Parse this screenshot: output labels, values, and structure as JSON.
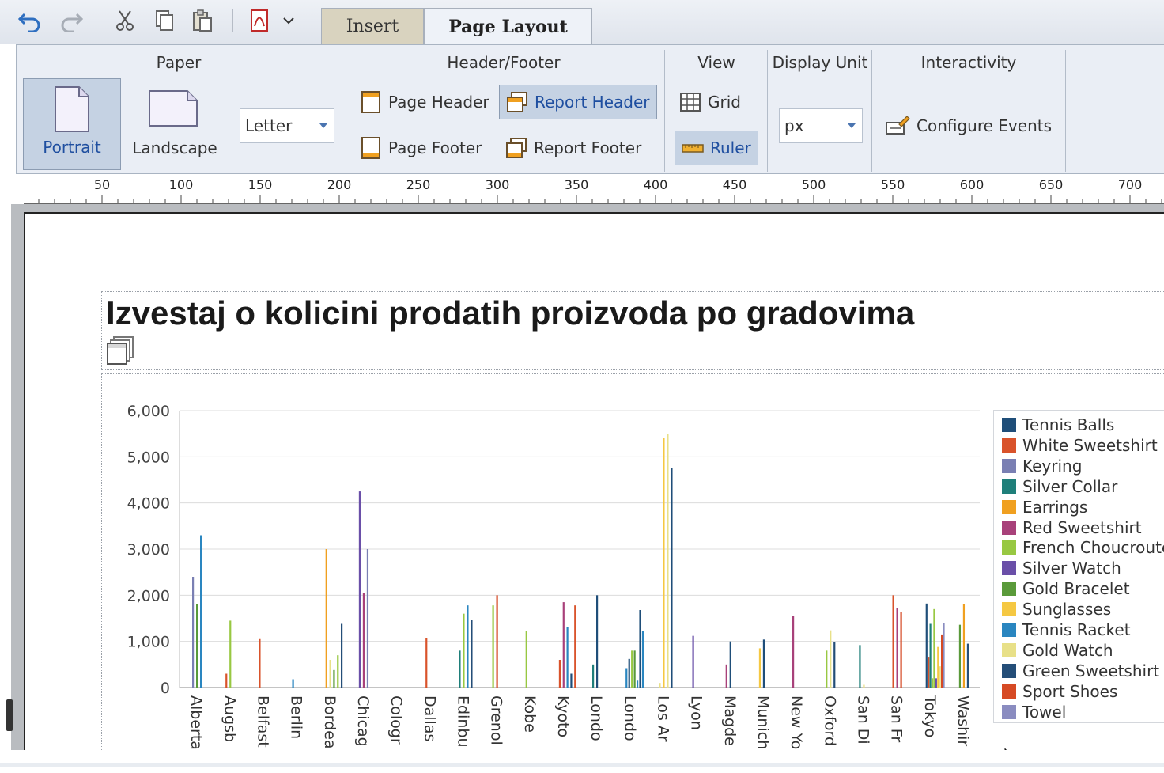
{
  "toolbar": {
    "icons": [
      "undo-icon",
      "redo-icon",
      "cut-icon",
      "copy-icon",
      "paste-icon",
      "pdf-icon",
      "chevron-down-icon"
    ]
  },
  "tabs": [
    {
      "label": "Insert",
      "active": false
    },
    {
      "label": "Page Layout",
      "active": true
    }
  ],
  "ribbon": {
    "paper": {
      "title": "Paper",
      "portrait": "Portrait",
      "landscape": "Landscape",
      "size": "Letter"
    },
    "header_footer": {
      "title": "Header/Footer",
      "page_header": "Page Header",
      "report_header": "Report Header",
      "page_footer": "Page Footer",
      "report_footer": "Report Footer"
    },
    "view": {
      "title": "View",
      "grid": "Grid",
      "ruler": "Ruler"
    },
    "display_unit": {
      "title": "Display Unit",
      "value": "px"
    },
    "interactivity": {
      "title": "Interactivity",
      "configure_events": "Configure Events"
    }
  },
  "ruler": {
    "labels": [
      "50",
      "100",
      "150",
      "200",
      "250",
      "300",
      "350",
      "400",
      "450",
      "500",
      "550",
      "600",
      "650",
      "700"
    ]
  },
  "report": {
    "title": "Izvestaj o kolicini prodatih proizvoda po gradovima"
  },
  "chart_data": {
    "type": "bar",
    "title": "",
    "xlabel": "",
    "ylabel": "",
    "ylim": [
      0,
      6000
    ],
    "yticks": [
      0,
      1000,
      2000,
      3000,
      4000,
      5000,
      6000
    ],
    "ytick_labels": [
      "0",
      "1,000",
      "2,000",
      "3,000",
      "4,000",
      "5,000",
      "6,000"
    ],
    "grid": true,
    "legend_position": "right",
    "categories": [
      "Alberta",
      "Augsburg",
      "Belfast",
      "Berlin",
      "Bordeaux",
      "Chicago",
      "Cologne",
      "Dallas",
      "Edinburgh",
      "Grenoble",
      "Kobe",
      "Kyoto",
      "London",
      "London",
      "Los Angeles",
      "Lyon",
      "Magdeburg",
      "Munich",
      "New York",
      "Oxford",
      "San Diego",
      "San Francisco",
      "Tokyo",
      "Washington"
    ],
    "category_labels": [
      "Alberta",
      "Augsb",
      "Belfast",
      "Berlin",
      "Bordea",
      "Chicag",
      "Cologr",
      "Dallas",
      "Edinbu",
      "Grenol",
      "Kobe",
      "Kyoto",
      "Londo",
      "Londo",
      "Los Ar",
      "Lyon",
      "Magde",
      "Munich",
      "New Yo",
      "Oxford",
      "San Di",
      "San Fr",
      "Tokyo",
      "Washir"
    ],
    "series": [
      {
        "name": "Tennis Balls",
        "color": "#1f4e79"
      },
      {
        "name": "White Sweetshirt",
        "color": "#d9532b"
      },
      {
        "name": "Keyring",
        "color": "#7a7fb3"
      },
      {
        "name": "Silver Collar",
        "color": "#1f7f7a"
      },
      {
        "name": "Earrings",
        "color": "#f0a020"
      },
      {
        "name": "Red Sweetshirt",
        "color": "#a8417a"
      },
      {
        "name": "French Choucroute",
        "color": "#98c842"
      },
      {
        "name": "Silver Watch",
        "color": "#6a4fa8"
      },
      {
        "name": "Gold Bracelet",
        "color": "#5a9a3a"
      },
      {
        "name": "Sunglasses",
        "color": "#f5c842"
      },
      {
        "name": "Tennis Racket",
        "color": "#2a86c0"
      },
      {
        "name": "Gold Watch",
        "color": "#e8e088"
      },
      {
        "name": "Green Sweetshirt",
        "color": "#244e78"
      },
      {
        "name": "Sport Shoes",
        "color": "#d64a24"
      },
      {
        "name": "Towel",
        "color": "#8a8cc0"
      }
    ],
    "bars": [
      {
        "category": 0,
        "series": "Keyring",
        "value": 2400
      },
      {
        "category": 0,
        "series": "Gold Bracelet",
        "value": 1800
      },
      {
        "category": 0,
        "series": "Tennis Racket",
        "value": 3300
      },
      {
        "category": 1,
        "series": "White Sweetshirt",
        "value": 300
      },
      {
        "category": 1,
        "series": "French Choucroute",
        "value": 1450
      },
      {
        "category": 2,
        "series": "White Sweetshirt",
        "value": 1050
      },
      {
        "category": 3,
        "series": "Tennis Racket",
        "value": 180
      },
      {
        "category": 4,
        "series": "Earrings",
        "value": 3000
      },
      {
        "category": 4,
        "series": "Gold Watch",
        "value": 600
      },
      {
        "category": 4,
        "series": "Gold Bracelet",
        "value": 380
      },
      {
        "category": 4,
        "series": "French Choucroute",
        "value": 700
      },
      {
        "category": 4,
        "series": "Green Sweetshirt",
        "value": 1380
      },
      {
        "category": 5,
        "series": "Silver Watch",
        "value": 4250
      },
      {
        "category": 5,
        "series": "Red Sweetshirt",
        "value": 2050
      },
      {
        "category": 5,
        "series": "Keyring",
        "value": 3000
      },
      {
        "category": 7,
        "series": "White Sweetshirt",
        "value": 1080
      },
      {
        "category": 8,
        "series": "Silver Collar",
        "value": 800
      },
      {
        "category": 8,
        "series": "French Choucroute",
        "value": 1600
      },
      {
        "category": 8,
        "series": "Tennis Racket",
        "value": 1780
      },
      {
        "category": 8,
        "series": "Green Sweetshirt",
        "value": 1460
      },
      {
        "category": 9,
        "series": "French Choucroute",
        "value": 1780
      },
      {
        "category": 9,
        "series": "Sport Shoes",
        "value": 2000
      },
      {
        "category": 10,
        "series": "French Choucroute",
        "value": 1220
      },
      {
        "category": 11,
        "series": "White Sweetshirt",
        "value": 600
      },
      {
        "category": 11,
        "series": "Red Sweetshirt",
        "value": 1850
      },
      {
        "category": 11,
        "series": "Tennis Racket",
        "value": 1320
      },
      {
        "category": 11,
        "series": "Tennis Balls",
        "value": 300
      },
      {
        "category": 11,
        "series": "White Sweetshirt",
        "value": 1780
      },
      {
        "category": 12,
        "series": "Silver Collar",
        "value": 500
      },
      {
        "category": 12,
        "series": "Tennis Balls",
        "value": 2000
      },
      {
        "category": 13,
        "series": "Tennis Racket",
        "value": 420
      },
      {
        "category": 13,
        "series": "Tennis Balls",
        "value": 620
      },
      {
        "category": 13,
        "series": "French Choucroute",
        "value": 800
      },
      {
        "category": 13,
        "series": "Gold Bracelet",
        "value": 800
      },
      {
        "category": 13,
        "series": "Tennis Racket",
        "value": 150
      },
      {
        "category": 13,
        "series": "Tennis Balls",
        "value": 1680
      },
      {
        "category": 13,
        "series": "Tennis Racket",
        "value": 1220
      },
      {
        "category": 14,
        "series": "Gold Watch",
        "value": 100
      },
      {
        "category": 14,
        "series": "Sunglasses",
        "value": 5400
      },
      {
        "category": 14,
        "series": "Gold Watch",
        "value": 5500
      },
      {
        "category": 14,
        "series": "Tennis Balls",
        "value": 4750
      },
      {
        "category": 15,
        "series": "Silver Watch",
        "value": 1120
      },
      {
        "category": 16,
        "series": "Red Sweetshirt",
        "value": 500
      },
      {
        "category": 16,
        "series": "Tennis Balls",
        "value": 1000
      },
      {
        "category": 17,
        "series": "Sunglasses",
        "value": 850
      },
      {
        "category": 17,
        "series": "Tennis Balls",
        "value": 1040
      },
      {
        "category": 18,
        "series": "Red Sweetshirt",
        "value": 1550
      },
      {
        "category": 19,
        "series": "French Choucroute",
        "value": 800
      },
      {
        "category": 19,
        "series": "Gold Watch",
        "value": 1240
      },
      {
        "category": 19,
        "series": "Green Sweetshirt",
        "value": 980
      },
      {
        "category": 20,
        "series": "Silver Collar",
        "value": 920
      },
      {
        "category": 20,
        "series": "Gold Watch",
        "value": 60
      },
      {
        "category": 21,
        "series": "White Sweetshirt",
        "value": 2000
      },
      {
        "category": 21,
        "series": "Red Sweetshirt",
        "value": 1720
      },
      {
        "category": 21,
        "series": "Sport Shoes",
        "value": 1640
      },
      {
        "category": 22,
        "series": "Tennis Balls",
        "value": 1820
      },
      {
        "category": 22,
        "series": "White Sweetshirt",
        "value": 650
      },
      {
        "category": 22,
        "series": "Silver Collar",
        "value": 1380
      },
      {
        "category": 22,
        "series": "French Choucroute",
        "value": 200
      },
      {
        "category": 22,
        "series": "French Choucroute",
        "value": 1700
      },
      {
        "category": 22,
        "series": "Silver Watch",
        "value": 200
      },
      {
        "category": 22,
        "series": "Sunglasses",
        "value": 880
      },
      {
        "category": 22,
        "series": "Gold Watch",
        "value": 460
      },
      {
        "category": 22,
        "series": "Sport Shoes",
        "value": 1150
      },
      {
        "category": 22,
        "series": "Towel",
        "value": 1390
      },
      {
        "category": 23,
        "series": "Gold Bracelet",
        "value": 1360
      },
      {
        "category": 23,
        "series": "Earrings",
        "value": 1800
      },
      {
        "category": 23,
        "series": "Green Sweetshirt",
        "value": 950
      }
    ]
  }
}
